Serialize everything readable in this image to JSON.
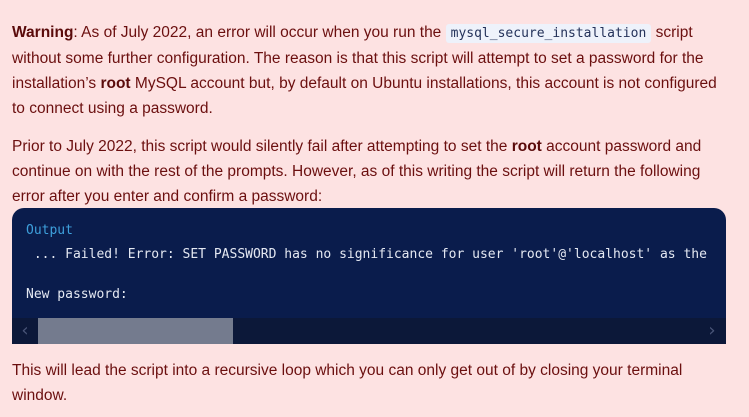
{
  "warning": {
    "label": "Warning",
    "t1": ": As of July 2022, an error will occur when you run the ",
    "code": "mysql_secure_installation",
    "t2": " script without some further configuration. The reason is that this script will attempt to set a password for the installation’s ",
    "bold_root": "root",
    "t3": " MySQL account but, by default on Ubuntu installations, this account is not configured to connect using a password."
  },
  "paragraph2": {
    "t1": "Prior to July 2022, this script would silently fail after attempting to set the ",
    "bold_root": "root",
    "t2": " account password and continue on with the rest of the prompts. However, as of this writing the script will return the following error after you enter and confirm a password:"
  },
  "terminal": {
    "label": "Output",
    "line1": " ... Failed! Error: SET PASSWORD has no significance for user 'root'@'localhost' as the",
    "line2": "New password:",
    "scroll_left_icon": "chevron-left-icon",
    "scroll_right_icon": "chevron-right-icon"
  },
  "paragraph3": {
    "text": "This will lead the script into a recursive loop which you can only get out of by closing your terminal window."
  },
  "colors": {
    "background": "#fde2e2",
    "text": "#6b0f0f",
    "terminal_bg": "#0a1c4c",
    "terminal_label": "#3ea0dc"
  }
}
